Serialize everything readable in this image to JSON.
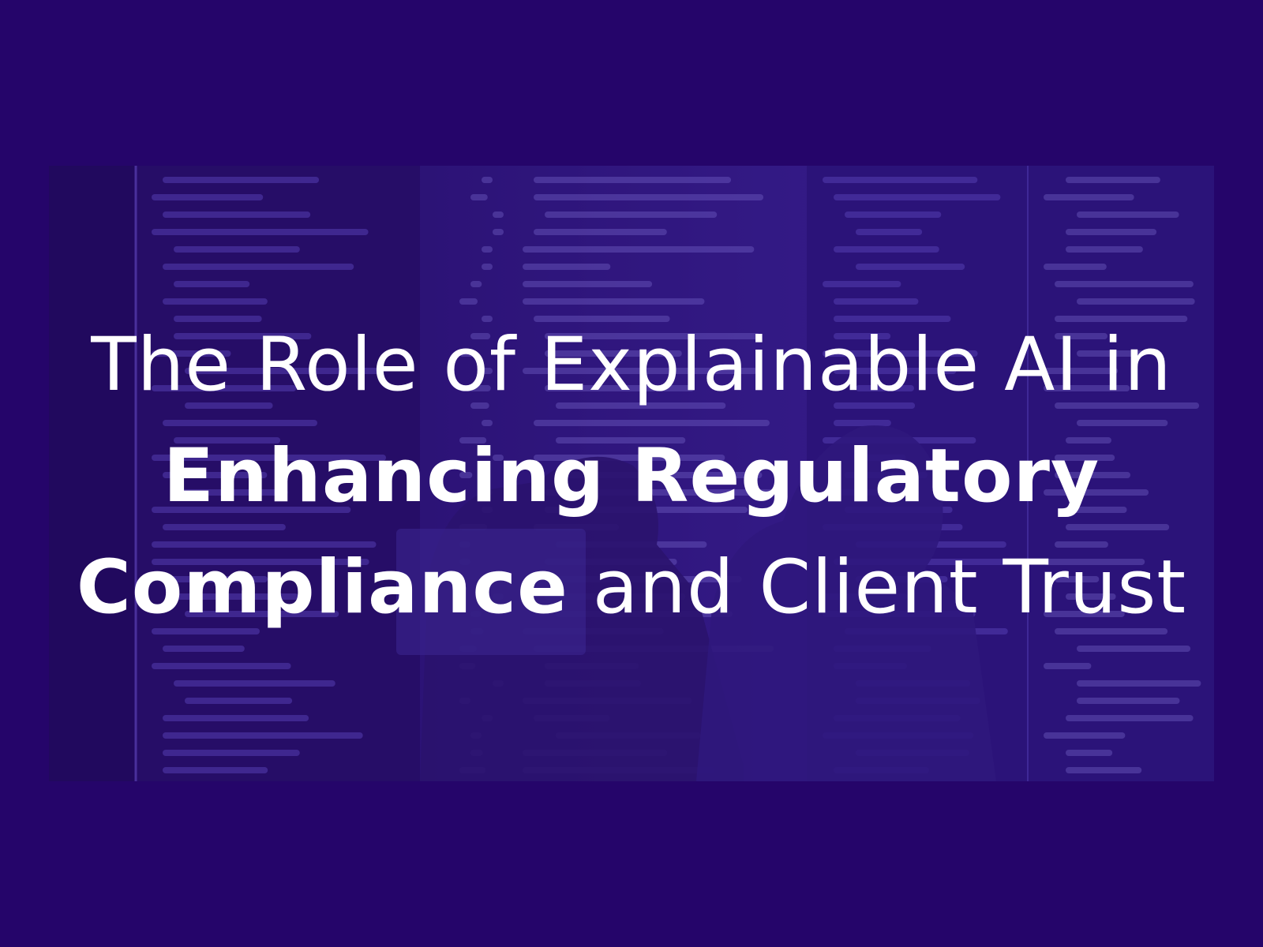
{
  "colors": {
    "background": "#25056a",
    "photo_tint": "#3b1c8c",
    "text": "#ffffff"
  },
  "image": {
    "description_icon": "people-at-code-screens-photo"
  },
  "headline": {
    "line1": "The Role of Explainable AI in",
    "line2_bold": "Enhancing Regulatory",
    "line3_bold": "Compliance",
    "line3_regular": " and Client Trust"
  }
}
